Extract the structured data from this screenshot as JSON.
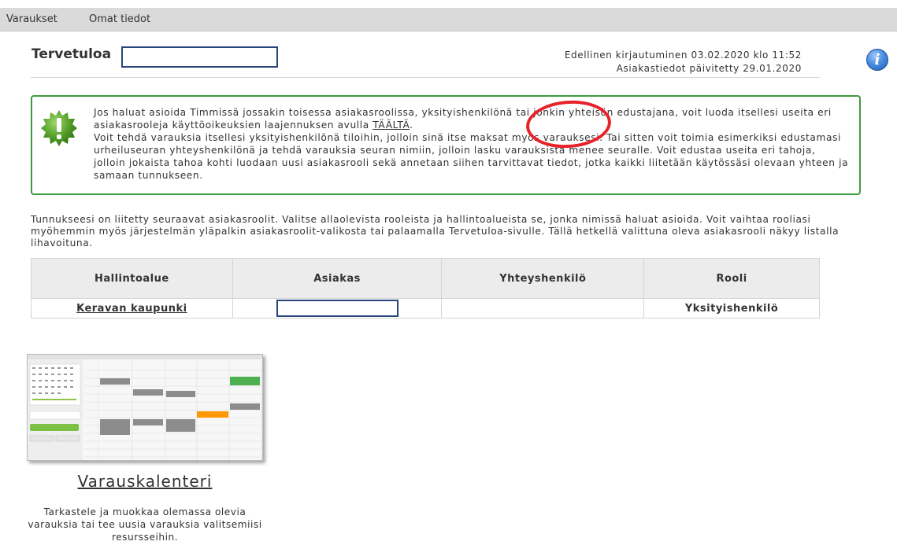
{
  "nav": {
    "items": [
      "Varaukset",
      "Omat tiedot"
    ]
  },
  "welcome": {
    "title": "Tervetuloa"
  },
  "login": {
    "last_login": "Edellinen kirjautuminen 03.02.2020 klo 11:52",
    "updated": "Asiakastiedot päivitetty 29.01.2020"
  },
  "info_icon": "i",
  "notice": {
    "line1_before": "Jos haluat asioida Timmissä jossakin toisessa asiakasroolissa, yksityishenkilönä tai jonkin yhteisön edustajana, voit luoda itsellesi useita eri asiakasrooleja käyttöoikeuksien laajennuksen avulla ",
    "link": "TÄÄLTÄ",
    "line1_after": ".",
    "line2": "Voit tehdä varauksia itsellesi yksityishenkilönä tiloihin, jolloin sinä itse maksat myös varauksesi. Tai sitten voit toimia esimerkiksi edustamasi urheiluseuran yhteyshenkilönä ja tehdä varauksia seuran nimiin, jolloin lasku varauksista menee seuralle. Voit edustaa useita eri tahoja, jolloin jokaista tahoa kohti luodaan uusi asiakasrooli sekä annetaan siihen tarvittavat tiedot, jotka kaikki liitetään käytössäsi olevaan yhteen ja samaan tunnukseen."
  },
  "intro": "Tunnukseesi on liitetty seuraavat asiakasroolit. Valitse allaolevista rooleista ja hallintoalueista se, jonka nimissä haluat asioida. Voit vaihtaa rooliasi myöhemmin myös järjestelmän yläpalkin asiakasroolit-valikosta tai palaamalla Tervetuloa-sivulle. Tällä hetkellä valittuna oleva asiakasrooli näkyy listalla lihavoituna.",
  "table": {
    "headers": [
      "Hallintoalue",
      "Asiakas",
      "Yhteyshenkilö",
      "Rooli"
    ],
    "row": {
      "area": "Keravan kaupunki",
      "customer": "",
      "contact": "",
      "role": "Yksityishenkilö"
    }
  },
  "tile": {
    "title": "Varauskalenteri",
    "description": "Tarkastele ja muokkaa olemassa olevia varauksia tai tee uusia varauksia valitsemiisi resursseihin."
  },
  "colors": {
    "nav_bg": "#dadada",
    "notice_border": "#3f9a3f",
    "highlight_red": "#e8222a",
    "box_border": "#27457a"
  }
}
